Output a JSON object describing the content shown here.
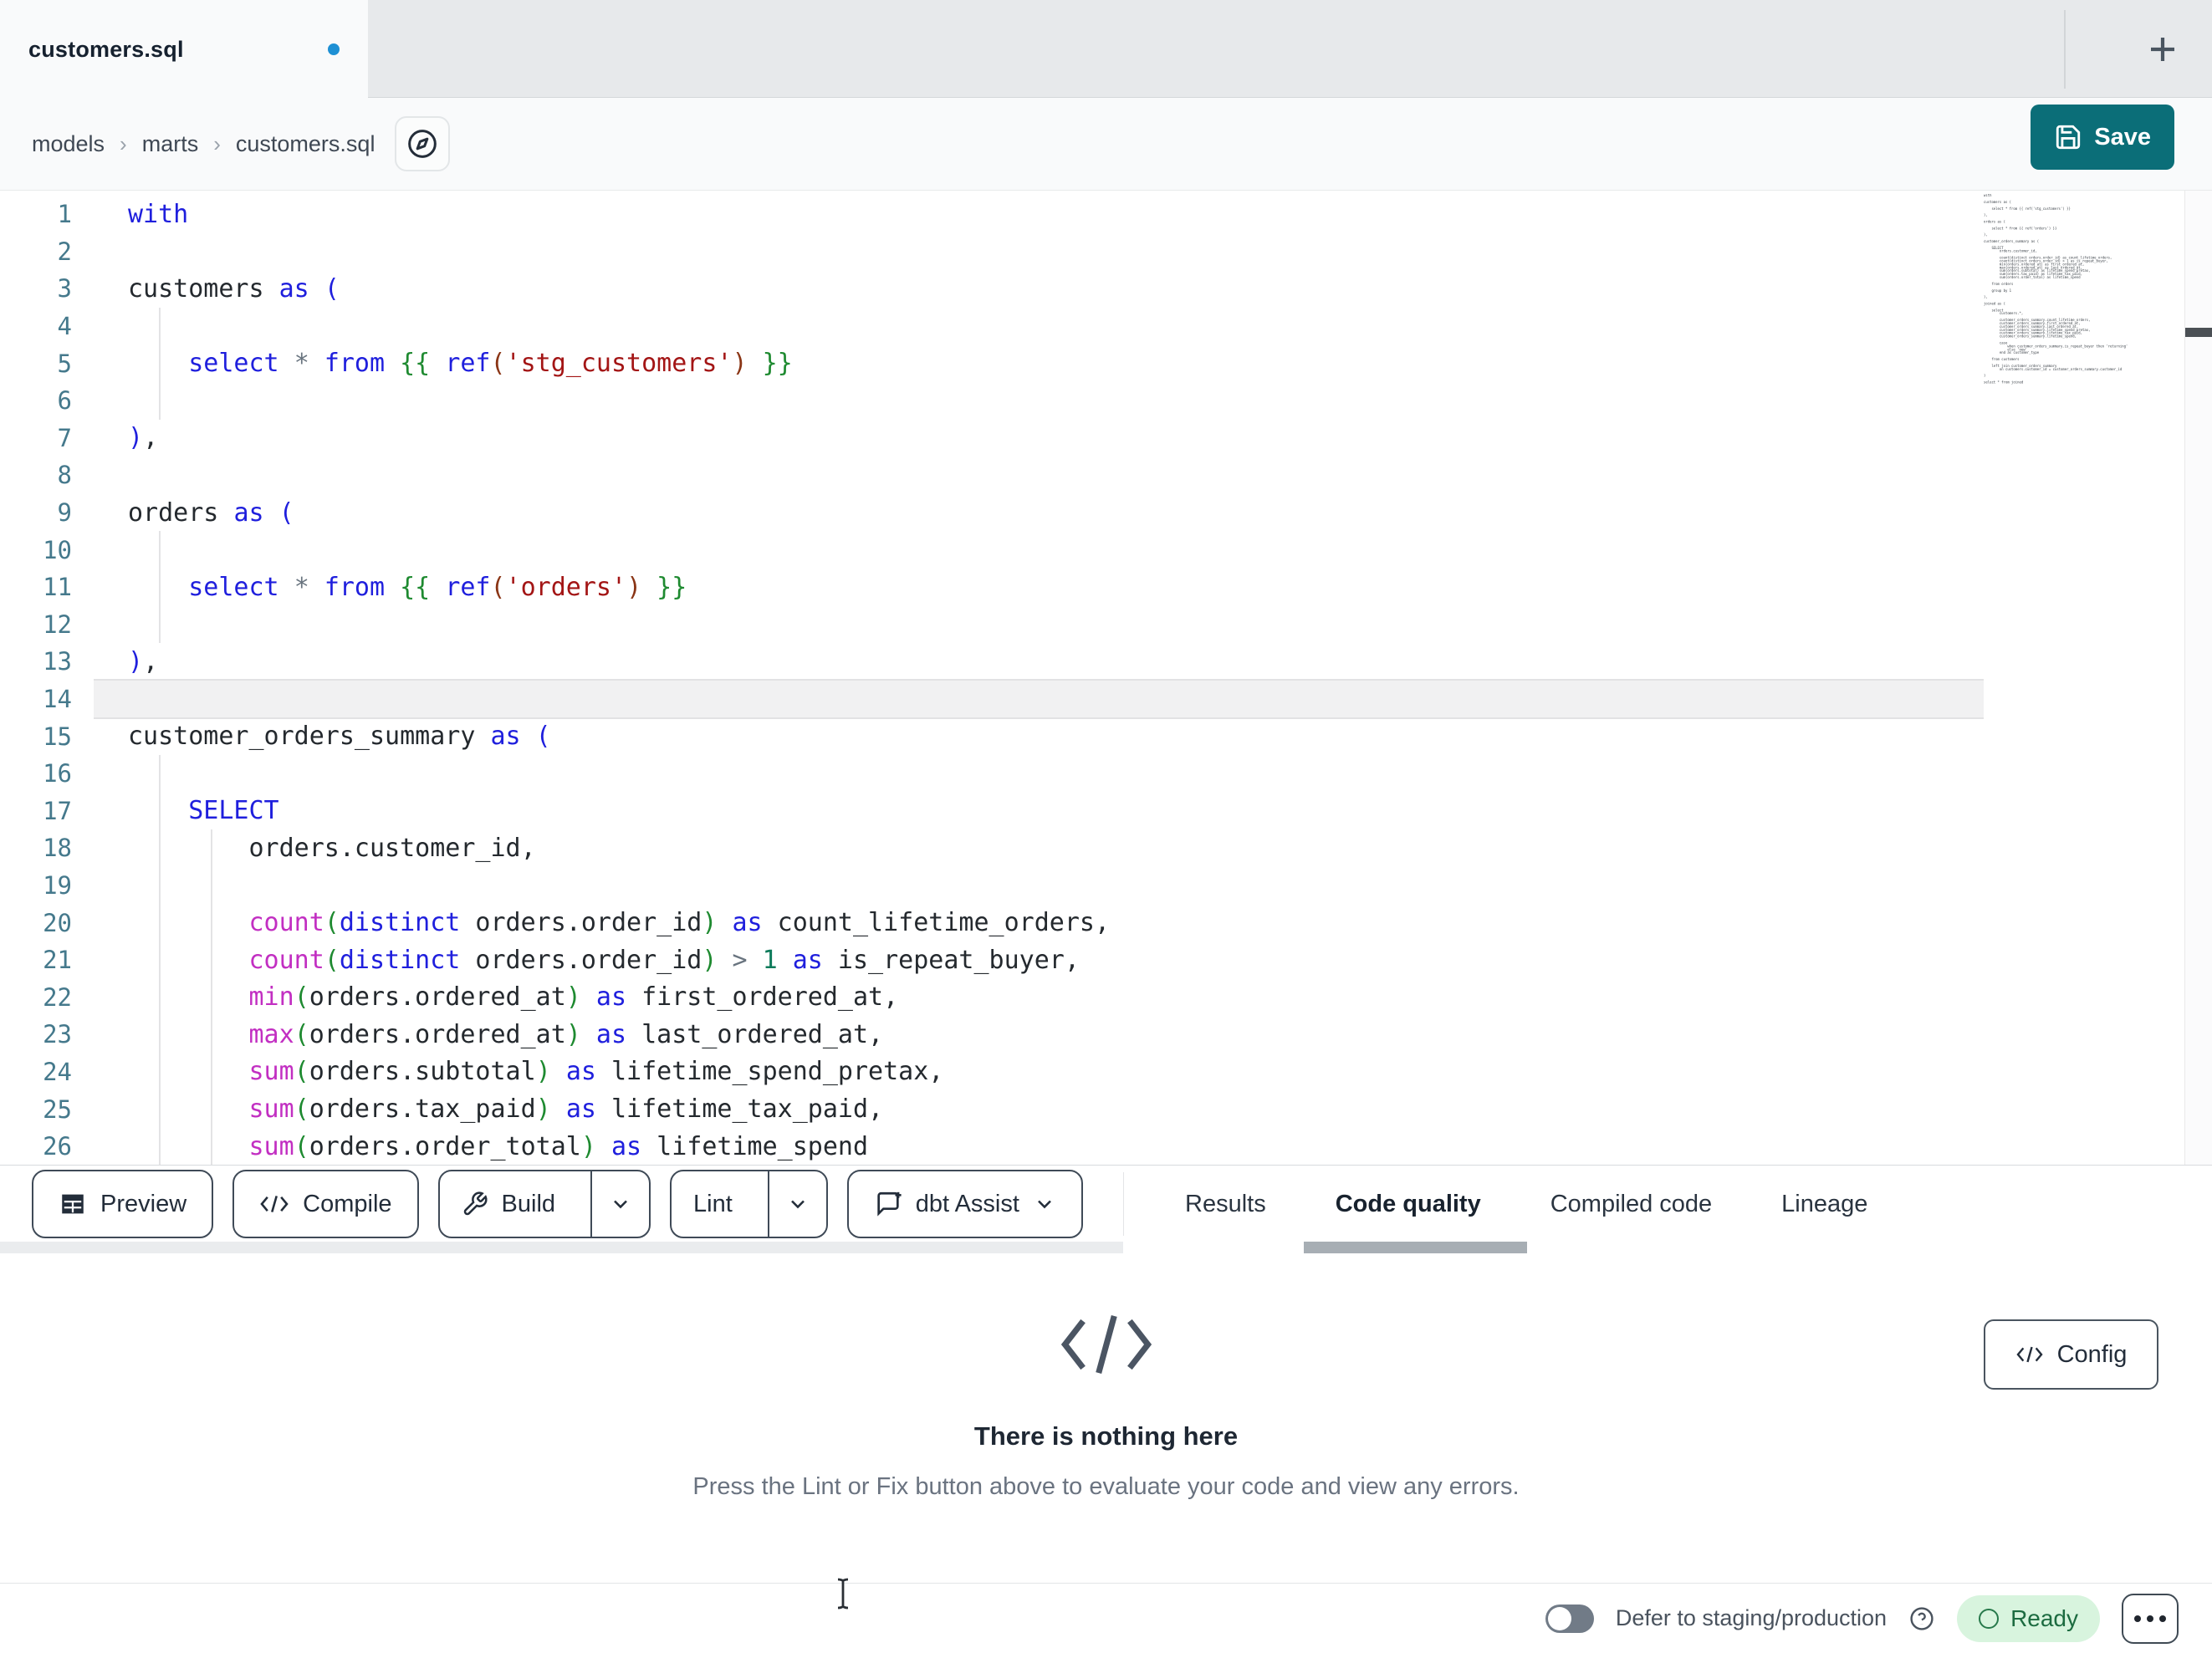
{
  "tab_bar": {
    "file_title": "customers.sql",
    "new_tab": "+"
  },
  "breadcrumb": {
    "items": [
      "models",
      "marts",
      "customers.sql"
    ],
    "separator": "›"
  },
  "save_button": {
    "label": "Save"
  },
  "editor": {
    "active_line": 14,
    "lines": [
      {
        "n": 1,
        "t": [
          [
            "kw",
            "with"
          ]
        ]
      },
      {
        "n": 2,
        "t": []
      },
      {
        "n": 3,
        "t": [
          [
            "pl",
            "customers "
          ],
          [
            "kw",
            "as "
          ],
          [
            "pb",
            "("
          ]
        ]
      },
      {
        "n": 4,
        "t": []
      },
      {
        "n": 5,
        "t": [
          [
            "pl",
            "    "
          ],
          [
            "kw",
            "select "
          ],
          [
            "op",
            "* "
          ],
          [
            "kw",
            "from "
          ],
          [
            "jj",
            "{{ "
          ],
          [
            "kw",
            "ref"
          ],
          [
            "pr",
            "("
          ],
          [
            "str",
            "'stg_customers'"
          ],
          [
            "pr",
            ")"
          ],
          [
            "jj",
            " }}"
          ]
        ]
      },
      {
        "n": 6,
        "t": []
      },
      {
        "n": 7,
        "t": [
          [
            "pb",
            ")"
          ],
          [
            "pl",
            ","
          ]
        ]
      },
      {
        "n": 8,
        "t": []
      },
      {
        "n": 9,
        "t": [
          [
            "pl",
            "orders "
          ],
          [
            "kw",
            "as "
          ],
          [
            "pb",
            "("
          ]
        ]
      },
      {
        "n": 10,
        "t": []
      },
      {
        "n": 11,
        "t": [
          [
            "pl",
            "    "
          ],
          [
            "kw",
            "select "
          ],
          [
            "op",
            "* "
          ],
          [
            "kw",
            "from "
          ],
          [
            "jj",
            "{{ "
          ],
          [
            "kw",
            "ref"
          ],
          [
            "pr",
            "("
          ],
          [
            "str",
            "'orders'"
          ],
          [
            "pr",
            ")"
          ],
          [
            "jj",
            " }}"
          ]
        ]
      },
      {
        "n": 12,
        "t": []
      },
      {
        "n": 13,
        "t": [
          [
            "pb",
            ")"
          ],
          [
            "pl",
            ","
          ]
        ]
      },
      {
        "n": 14,
        "t": []
      },
      {
        "n": 15,
        "t": [
          [
            "pl",
            "customer_orders_summary "
          ],
          [
            "kw",
            "as "
          ],
          [
            "pb",
            "("
          ]
        ]
      },
      {
        "n": 16,
        "t": []
      },
      {
        "n": 17,
        "t": [
          [
            "pl",
            "    "
          ],
          [
            "kw",
            "SELECT"
          ]
        ]
      },
      {
        "n": 18,
        "t": [
          [
            "pl",
            "        orders.customer_id,"
          ]
        ]
      },
      {
        "n": 19,
        "t": []
      },
      {
        "n": 20,
        "t": [
          [
            "pl",
            "        "
          ],
          [
            "fn",
            "count"
          ],
          [
            "pg",
            "("
          ],
          [
            "kw",
            "distinct"
          ],
          [
            "pl",
            " orders.order_id"
          ],
          [
            "pg",
            ")"
          ],
          [
            "pl",
            " "
          ],
          [
            "kw",
            "as"
          ],
          [
            "pl",
            " count_lifetime_orders,"
          ]
        ]
      },
      {
        "n": 21,
        "t": [
          [
            "pl",
            "        "
          ],
          [
            "fn",
            "count"
          ],
          [
            "pg",
            "("
          ],
          [
            "kw",
            "distinct"
          ],
          [
            "pl",
            " orders.order_id"
          ],
          [
            "pg",
            ")"
          ],
          [
            "pl",
            " "
          ],
          [
            "op",
            ">"
          ],
          [
            "pl",
            " "
          ],
          [
            "num",
            "1"
          ],
          [
            "pl",
            " "
          ],
          [
            "kw",
            "as"
          ],
          [
            "pl",
            " is_repeat_buyer,"
          ]
        ]
      },
      {
        "n": 22,
        "t": [
          [
            "pl",
            "        "
          ],
          [
            "fn",
            "min"
          ],
          [
            "pg",
            "("
          ],
          [
            "pl",
            "orders.ordered_at"
          ],
          [
            "pg",
            ")"
          ],
          [
            "pl",
            " "
          ],
          [
            "kw",
            "as"
          ],
          [
            "pl",
            " first_ordered_at,"
          ]
        ]
      },
      {
        "n": 23,
        "t": [
          [
            "pl",
            "        "
          ],
          [
            "fn",
            "max"
          ],
          [
            "pg",
            "("
          ],
          [
            "pl",
            "orders.ordered_at"
          ],
          [
            "pg",
            ")"
          ],
          [
            "pl",
            " "
          ],
          [
            "kw",
            "as"
          ],
          [
            "pl",
            " last_ordered_at,"
          ]
        ]
      },
      {
        "n": 24,
        "t": [
          [
            "pl",
            "        "
          ],
          [
            "fn",
            "sum"
          ],
          [
            "pg",
            "("
          ],
          [
            "pl",
            "orders.subtotal"
          ],
          [
            "pg",
            ")"
          ],
          [
            "pl",
            " "
          ],
          [
            "kw",
            "as"
          ],
          [
            "pl",
            " lifetime_spend_pretax,"
          ]
        ]
      },
      {
        "n": 25,
        "t": [
          [
            "pl",
            "        "
          ],
          [
            "fn",
            "sum"
          ],
          [
            "pg",
            "("
          ],
          [
            "pl",
            "orders.tax_paid"
          ],
          [
            "pg",
            ")"
          ],
          [
            "pl",
            " "
          ],
          [
            "kw",
            "as"
          ],
          [
            "pl",
            " lifetime_tax_paid,"
          ]
        ]
      },
      {
        "n": 26,
        "t": [
          [
            "pl",
            "        "
          ],
          [
            "fn",
            "sum"
          ],
          [
            "pg",
            "("
          ],
          [
            "pl",
            "orders.order_total"
          ],
          [
            "pg",
            ")"
          ],
          [
            "pl",
            " "
          ],
          [
            "kw",
            "as"
          ],
          [
            "pl",
            " lifetime_spend"
          ]
        ]
      }
    ],
    "indent_guides": [
      {
        "x": 37,
        "from": 4,
        "to": 6
      },
      {
        "x": 37,
        "from": 10,
        "to": 12
      },
      {
        "x": 37,
        "from": 16,
        "to": 26
      },
      {
        "x": 99,
        "from": 18,
        "to": 26
      }
    ]
  },
  "minimap": {
    "lines": [
      "with",
      "",
      "customers as (",
      "",
      "    select * from {{ ref('stg_customers') }}",
      "",
      "),",
      "",
      "orders as (",
      "",
      "    select * from {{ ref('orders') }}",
      "",
      "),",
      "",
      "customer_orders_summary as (",
      "",
      "    SELECT",
      "        orders.customer_id,",
      "",
      "        count(distinct orders.order_id) as count_lifetime_orders,",
      "        count(distinct orders.order_id) > 1 as is_repeat_buyer,",
      "        min(orders.ordered_at) as first_ordered_at,",
      "        max(orders.ordered_at) as last_ordered_at,",
      "        sum(orders.subtotal) as lifetime_spend_pretax,",
      "        sum(orders.tax_paid) as lifetime_tax_paid,",
      "        sum(orders.order_total) as lifetime_spend",
      "",
      "    from orders",
      "",
      "    group by 1",
      "",
      "),",
      "",
      "joined as (",
      "",
      "    select",
      "        customers.*,",
      "",
      "        customer_orders_summary.count_lifetime_orders,",
      "        customer_orders_summary.first_ordered_at,",
      "        customer_orders_summary.last_ordered_at,",
      "        customer_orders_summary.lifetime_spend_pretax,",
      "        customer_orders_summary.lifetime_tax_paid,",
      "        customer_orders_summary.lifetime_spend,",
      "",
      "        case",
      "            when customer_orders_summary.is_repeat_buyer then 'returning'",
      "            else 'new'",
      "        end as customer_type",
      "",
      "    from customers",
      "",
      "    left join customer_orders_summary",
      "        on customers.customer_id = customer_orders_summary.customer_id",
      "",
      ")",
      "",
      "select * from joined"
    ]
  },
  "toolbar": {
    "preview_label": "Preview",
    "compile_label": "Compile",
    "build_label": "Build",
    "lint_label": "Lint",
    "assist_label": "dbt Assist"
  },
  "panel_tabs": [
    {
      "label": "Results"
    },
    {
      "label": "Code quality",
      "active": true
    },
    {
      "label": "Compiled code"
    },
    {
      "label": "Lineage"
    }
  ],
  "panel": {
    "empty_title": "There is nothing here",
    "empty_hint": "Press the Lint or Fix button above to evaluate your code and view any errors.",
    "config_label": "Config"
  },
  "footer": {
    "defer_label": "Defer to staging/production",
    "status_label": "Ready"
  },
  "colors": {
    "accent_teal": "#0b6e78",
    "unsaved_dot_blue": "#1e90d4",
    "ready_bg": "#d8f4de",
    "ready_text": "#1c6b40",
    "keyword_blue": "#1f1fdd",
    "string_red": "#a31515",
    "builtin_magenta": "#c22fc2",
    "jinja_green": "#1e8a30",
    "line_number_teal": "#45798c"
  }
}
